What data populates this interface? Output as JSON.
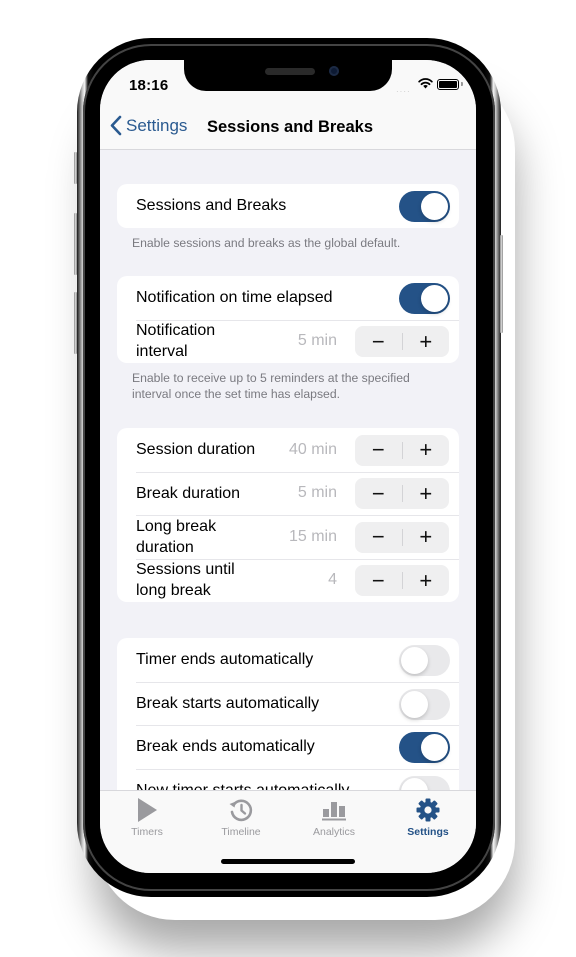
{
  "status_bar": {
    "time": "18:16",
    "signal": "····"
  },
  "nav": {
    "back_label": "Settings",
    "title": "Sessions and Breaks"
  },
  "colors": {
    "accent": "#245287",
    "toggle_off": "#e9e9eb",
    "background": "#f2f2f7"
  },
  "sections": {
    "global": {
      "label": "Sessions and Breaks",
      "enabled": true,
      "footnote": "Enable sessions and breaks as the global default."
    },
    "notification": {
      "toggle_label": "Notification on time elapsed",
      "toggle_on": true,
      "interval_label": "Notification interval",
      "interval_value": "5 min",
      "footnote": "Enable to receive up to 5 reminders at the specified interval once the set time has elapsed."
    },
    "durations": [
      {
        "label": "Session duration",
        "value": "40 min"
      },
      {
        "label": "Break duration",
        "value": "5 min"
      },
      {
        "label": "Long break duration",
        "value": "15 min"
      },
      {
        "label": "Sessions until long break",
        "value": "4"
      }
    ],
    "automation": [
      {
        "label": "Timer ends automatically",
        "on": false
      },
      {
        "label": "Break starts automatically",
        "on": false
      },
      {
        "label": "Break ends automatically",
        "on": true
      },
      {
        "label": "New timer starts automatically",
        "on": false
      }
    ]
  },
  "stepper": {
    "minus": "−",
    "plus": "+"
  },
  "tabbar": {
    "tabs": [
      {
        "label": "Timers",
        "icon": "play-icon",
        "active": false
      },
      {
        "label": "Timeline",
        "icon": "history-icon",
        "active": false
      },
      {
        "label": "Analytics",
        "icon": "bar-chart-icon",
        "active": false
      },
      {
        "label": "Settings",
        "icon": "gear-icon",
        "active": true
      }
    ]
  }
}
